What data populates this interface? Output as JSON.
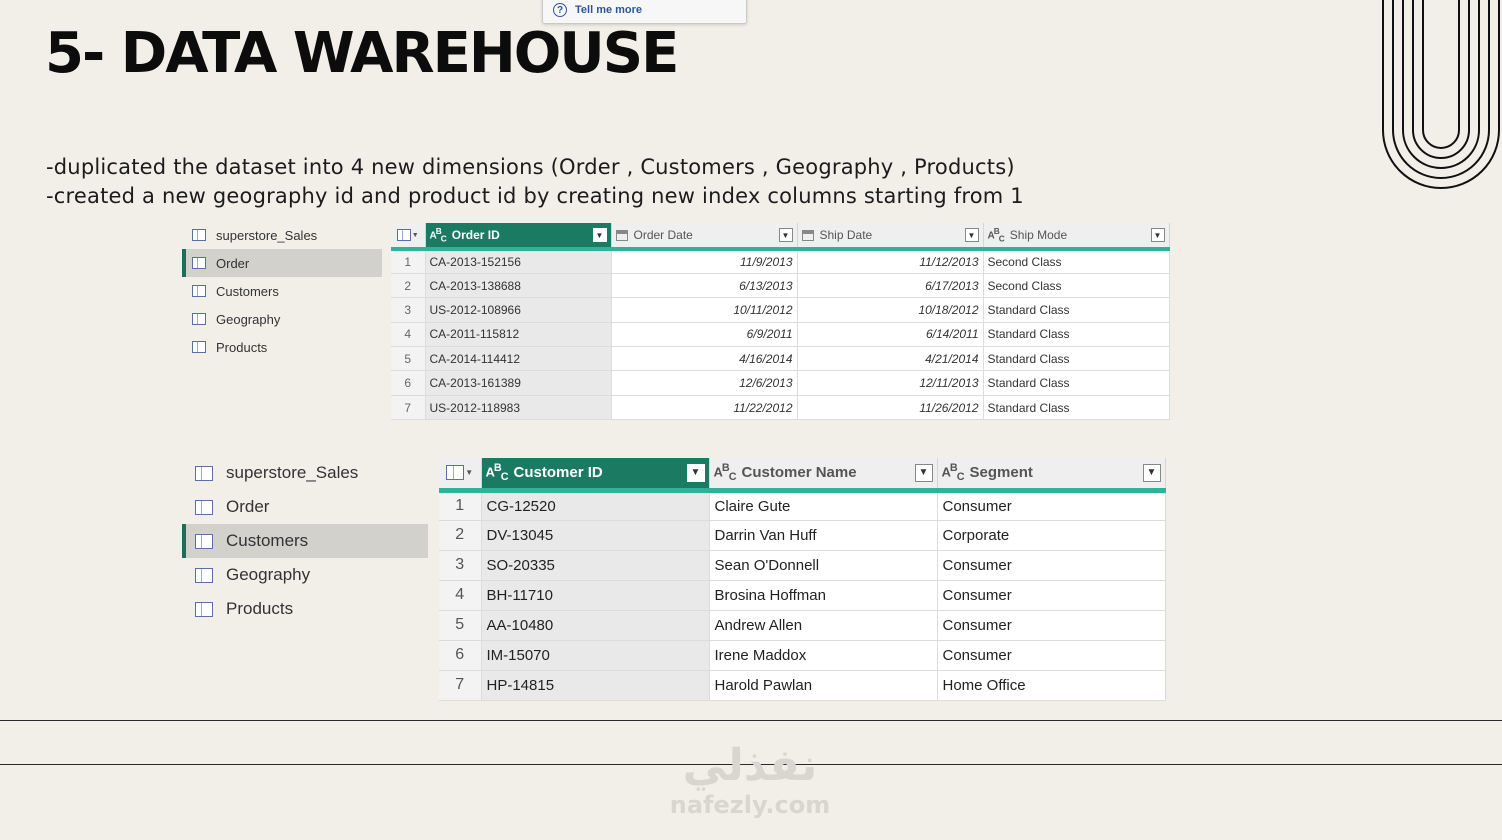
{
  "tooltip": {
    "text": "Tell me more"
  },
  "title": "5- DATA WAREHOUSE",
  "description": {
    "line1": "-duplicated the dataset into 4 new dimensions (Order , Customers , Geography , Products)",
    "line2": "-created a new geography id and product id by creating new index columns starting from 1"
  },
  "queries_panel_1": {
    "items": [
      "superstore_Sales",
      "Order",
      "Customers",
      "Geography",
      "Products"
    ],
    "active": "Order"
  },
  "order_table": {
    "columns": [
      "Order ID",
      "Order Date",
      "Ship Date",
      "Ship Mode"
    ],
    "rows": [
      [
        "1",
        "CA-2013-152156",
        "11/9/2013",
        "11/12/2013",
        "Second Class"
      ],
      [
        "2",
        "CA-2013-138688",
        "6/13/2013",
        "6/17/2013",
        "Second Class"
      ],
      [
        "3",
        "US-2012-108966",
        "10/11/2012",
        "10/18/2012",
        "Standard Class"
      ],
      [
        "4",
        "CA-2011-115812",
        "6/9/2011",
        "6/14/2011",
        "Standard Class"
      ],
      [
        "5",
        "CA-2014-114412",
        "4/16/2014",
        "4/21/2014",
        "Standard Class"
      ],
      [
        "6",
        "CA-2013-161389",
        "12/6/2013",
        "12/11/2013",
        "Standard Class"
      ],
      [
        "7",
        "US-2012-118983",
        "11/22/2012",
        "11/26/2012",
        "Standard Class"
      ]
    ]
  },
  "queries_panel_2": {
    "items": [
      "superstore_Sales",
      "Order",
      "Customers",
      "Geography",
      "Products"
    ],
    "active": "Customers"
  },
  "customers_table": {
    "columns": [
      "Customer ID",
      "Customer Name",
      "Segment"
    ],
    "rows": [
      [
        "1",
        "CG-12520",
        "Claire Gute",
        "Consumer"
      ],
      [
        "2",
        "DV-13045",
        "Darrin Van Huff",
        "Corporate"
      ],
      [
        "3",
        "SO-20335",
        "Sean O'Donnell",
        "Consumer"
      ],
      [
        "4",
        "BH-11710",
        "Brosina Hoffman",
        "Consumer"
      ],
      [
        "5",
        "AA-10480",
        "Andrew Allen",
        "Consumer"
      ],
      [
        "6",
        "IM-15070",
        "Irene Maddox",
        "Consumer"
      ],
      [
        "7",
        "HP-14815",
        "Harold Pawlan",
        "Home Office"
      ]
    ]
  },
  "watermark": {
    "arabic": "نفذلي",
    "latin": "nafezly.com"
  },
  "colors": {
    "accent": "#1b7a62",
    "underline": "#2db39a",
    "background": "#f2efe8"
  }
}
